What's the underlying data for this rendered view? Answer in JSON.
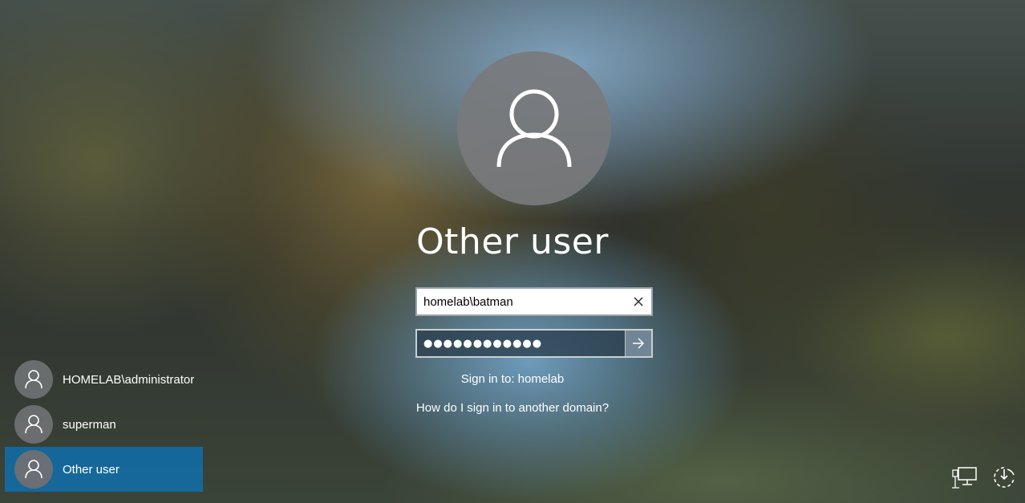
{
  "login": {
    "title": "Other user",
    "username_value": "homelab\\batman",
    "password_mask": "●●●●●●●●●●●●",
    "sign_in_to": "Sign in to: homelab",
    "other_domain_link": "How do I sign in to another domain?",
    "clear_icon": "close-icon",
    "submit_icon": "arrow-right-icon"
  },
  "users": [
    {
      "name": "HOMELAB\\administrator",
      "selected": false
    },
    {
      "name": "superman",
      "selected": false
    },
    {
      "name": "Other user",
      "selected": true
    }
  ],
  "corner": {
    "network_icon": "network-icon",
    "power_icon": "power-icon"
  },
  "colors": {
    "selected_user_bg": "#0f6eaa",
    "avatar_bg": "#787a7c"
  }
}
